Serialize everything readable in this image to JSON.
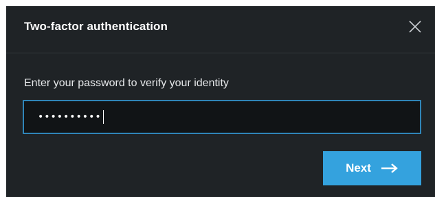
{
  "dialog": {
    "title": "Two-factor authentication",
    "close_icon": "close-icon",
    "prompt": "Enter your password to verify your identity",
    "password_value": "••••••••••",
    "next_label": "Next",
    "next_icon": "arrow-right-icon"
  },
  "colors": {
    "background": "#1f2326",
    "input_background": "#111416",
    "input_border_focus": "#2f85b8",
    "button_primary": "#34a2de",
    "text": "#ffffff"
  }
}
